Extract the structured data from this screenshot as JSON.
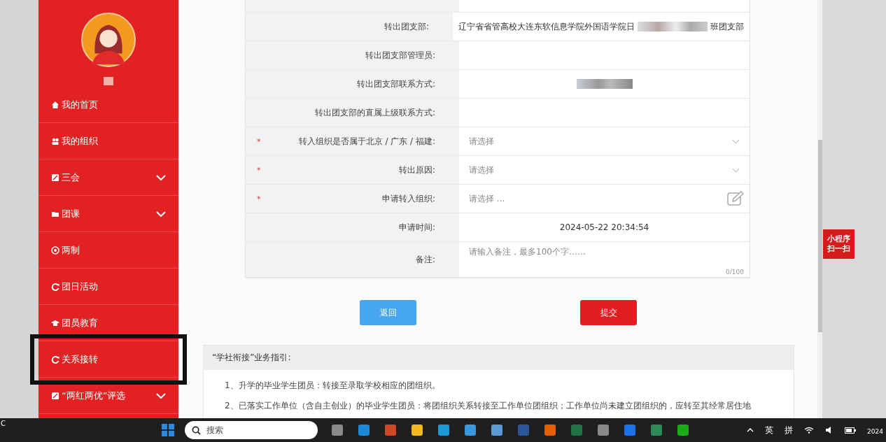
{
  "sidebar": {
    "items": [
      {
        "label": "我的首页",
        "expandable": false,
        "highlighted": false
      },
      {
        "label": "我的组织",
        "expandable": false,
        "highlighted": false
      },
      {
        "label": "三会",
        "expandable": true,
        "highlighted": false
      },
      {
        "label": "团课",
        "expandable": true,
        "highlighted": false
      },
      {
        "label": "两制",
        "expandable": false,
        "highlighted": false
      },
      {
        "label": "团日活动",
        "expandable": false,
        "highlighted": false
      },
      {
        "label": "团员教育",
        "expandable": false,
        "highlighted": false
      },
      {
        "label": "关系接转",
        "expandable": false,
        "highlighted": true
      },
      {
        "label": "“两红两优”评选",
        "expandable": true,
        "highlighted": false
      }
    ]
  },
  "form": {
    "rows": [
      {
        "kind": "text",
        "label": "转出团支部:",
        "value": "辽宁省省管高校大连东软信息学院外国语学院日",
        "value_end": "班团支部",
        "redacted": true
      },
      {
        "kind": "text",
        "label": "转出团支部管理员:"
      },
      {
        "kind": "text",
        "label": "转出团支部联系方式:",
        "redacted": true
      },
      {
        "kind": "text",
        "label": "转出团支部的直属上级联系方式:"
      },
      {
        "kind": "select",
        "label": "转入组织是否属于北京 / 广东 / 福建:",
        "required_mark": "*",
        "placeholder": "请选择"
      },
      {
        "kind": "select",
        "label": "转出原因:",
        "required_mark": "*",
        "placeholder": "请选择"
      },
      {
        "kind": "picker",
        "label": "申请转入组织:",
        "required_mark": "*",
        "placeholder": "请选择 ..."
      },
      {
        "kind": "text",
        "label": "申请时间:",
        "value": "2024-05-22 20:34:54"
      },
      {
        "kind": "textarea",
        "label": "备注:",
        "placeholder": "请输入备注，最多100个字……",
        "counter": "0/100"
      }
    ]
  },
  "buttons": [
    {
      "label": "返回",
      "kind": "back"
    },
    {
      "label": "提交",
      "kind": "submit"
    }
  ],
  "guide": {
    "title": "“学社衔接”业务指引:",
    "items": [
      "1、升学的毕业学生团员：转接至录取学校相应的团组织。",
      "2、已落实工作单位（含自主创业）的毕业学生团员：将团组织关系转接至工作单位团组织；工作单位尚未建立团组织的，应转至其经常居住地"
    ]
  },
  "side_badge": {
    "lines": [
      "小程序",
      "扫一扫"
    ]
  },
  "taskbar": {
    "edge_text": "C",
    "search_placeholder": "搜索",
    "tray": [
      "英",
      "拼"
    ],
    "clock": "2024"
  }
}
